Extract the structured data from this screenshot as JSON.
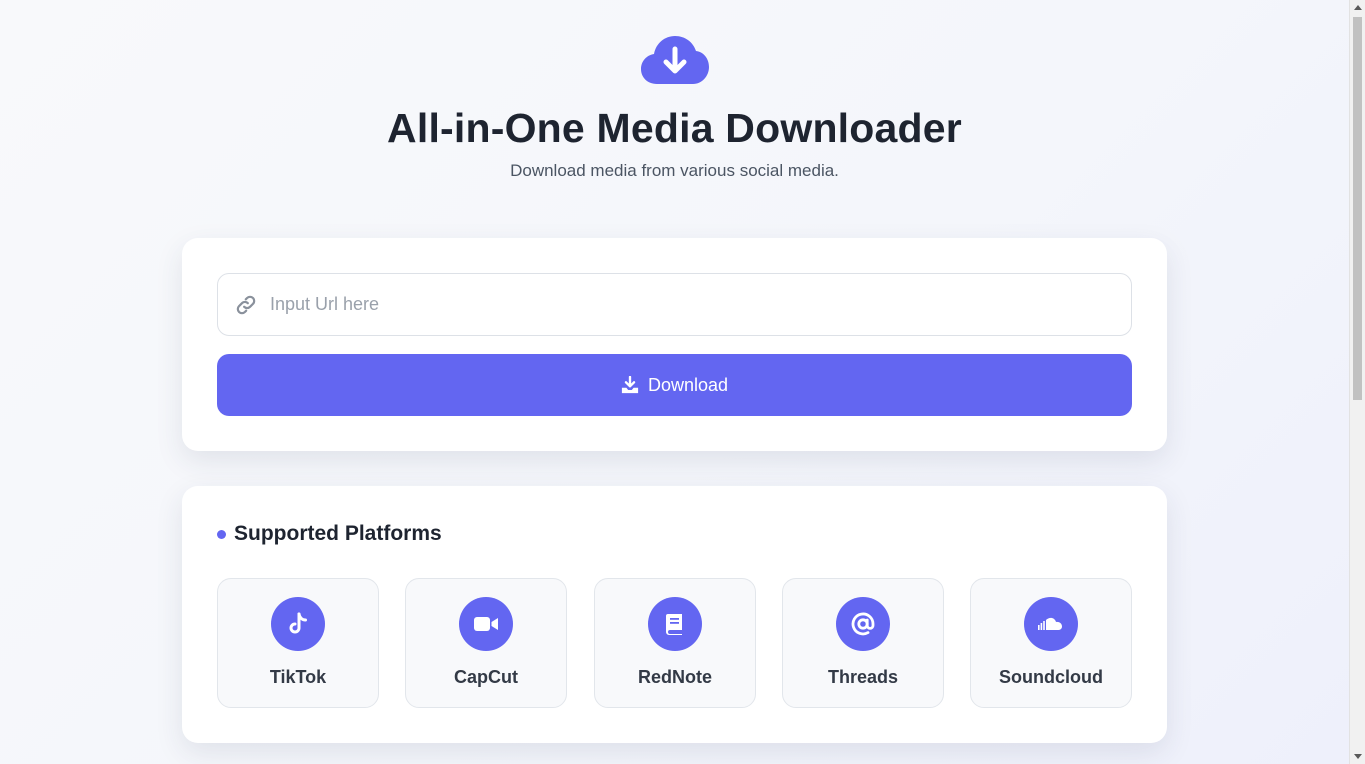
{
  "header": {
    "icon": "cloud-download-icon",
    "title": "All-in-One Media Downloader",
    "subtitle": "Download media from various social media."
  },
  "download_form": {
    "input_icon": "link-icon",
    "url_placeholder": "Input Url here",
    "url_value": "",
    "button_icon": "download-icon",
    "button_label": "Download"
  },
  "platforms": {
    "title": "Supported Platforms",
    "items": [
      {
        "name": "TikTok",
        "icon": "tiktok-icon"
      },
      {
        "name": "CapCut",
        "icon": "video-camera-icon"
      },
      {
        "name": "RedNote",
        "icon": "book-icon"
      },
      {
        "name": "Threads",
        "icon": "at-sign-icon"
      },
      {
        "name": "Soundcloud",
        "icon": "soundcloud-icon"
      }
    ]
  },
  "colors": {
    "accent": "#6366f1",
    "title_text": "#1e2430",
    "subtitle_text": "#4b5563",
    "tile_background": "#f8f9fb"
  }
}
